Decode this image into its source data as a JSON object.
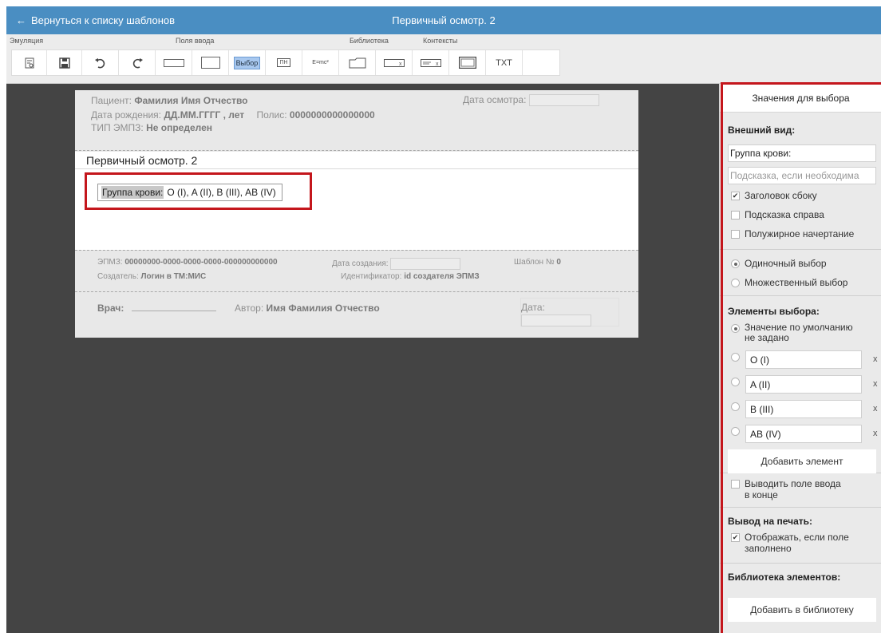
{
  "header": {
    "back_label": "Вернуться к списку шаблонов",
    "title": "Первичный осмотр. 2"
  },
  "toolbar": {
    "groups": {
      "emulation": "Эмуляция",
      "input_fields": "Поля ввода",
      "library": "Библиотека",
      "contexts": "Контексты"
    },
    "select_label": "Выбор",
    "calendar_label": "ПН",
    "formula_label": "E=mc²",
    "txt_label": "TXT"
  },
  "document": {
    "patient_label": "Пациент:",
    "patient_value": "Фамилия Имя Отчество",
    "exam_date_label": "Дата осмотра:",
    "birth_label": "Дата рождения:",
    "birth_value": "ДД.ММ.ГГГГ , лет",
    "policy_label": "Полис:",
    "policy_value": "0000000000000000",
    "emz_type_label": "ТИП ЭМПЗ:",
    "emz_type_value": "Не определен",
    "section_title": "Первичный осмотр. 2",
    "field": {
      "label": "Группа крови:",
      "options": [
        "O (I),",
        "A (II),",
        "B (III),",
        "AB (IV)"
      ]
    },
    "footer": {
      "emz_label": "ЭПМЗ:",
      "emz_value": "00000000-0000-0000-0000-000000000000",
      "created_label": "Дата создания:",
      "template_label": "Шаблон №",
      "template_value": "0",
      "creator_label": "Создатель:",
      "creator_value": "Логин в ТМ:МИС",
      "id_label": "Идентификатор:",
      "id_value": "id создателя ЭПМЗ",
      "doctor_label": "Врач:",
      "author_label": "Автор:",
      "author_value": "Имя Фамилия Отчество",
      "date_label": "Дата:"
    }
  },
  "panel": {
    "title": "Значения для выбора",
    "appearance_heading": "Внешний вид:",
    "label_value": "Группа крови:",
    "hint_placeholder": "Подсказка, если необходима",
    "opt_label_side": "Заголовок сбоку",
    "opt_hint_right": "Подсказка справа",
    "opt_bold": "Полужирное начертание",
    "single_choice": "Одиночный выбор",
    "multi_choice": "Множественный выбор",
    "elements_heading": "Элементы выбора:",
    "default_line1": "Значение по умолчанию",
    "default_line2": "не задано",
    "elements": [
      "O (I)",
      "A (II)",
      "B (III)",
      "AB (IV)"
    ],
    "remove_symbol": "x",
    "add_element": "Добавить элемент",
    "input_at_end_line1": "Выводить поле ввода",
    "input_at_end_line2": "в конце",
    "print_heading": "Вывод на печать:",
    "print_line1": "Отображать, если поле",
    "print_line2": "заполнено",
    "library_heading": "Библиотека элементов:",
    "add_to_library": "Добавить в библиотеку"
  }
}
